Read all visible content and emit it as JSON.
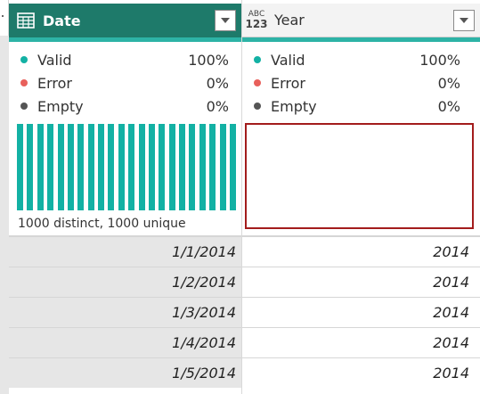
{
  "columns": {
    "date": {
      "title": "Date",
      "type_icon": "calendar-table-icon",
      "stats": {
        "valid_label": "Valid",
        "valid_value": "100%",
        "error_label": "Error",
        "error_value": "0%",
        "empty_label": "Empty",
        "empty_value": "0%"
      },
      "distribution_summary": "1000 distinct, 1000 unique",
      "histogram_bar_count": 22
    },
    "year": {
      "title": "Year",
      "type_icon_top": "ABC",
      "type_icon_bottom": "123",
      "stats": {
        "valid_label": "Valid",
        "valid_value": "100%",
        "error_label": "Error",
        "error_value": "0%",
        "empty_label": "Empty",
        "empty_value": "0%"
      }
    }
  },
  "rows": [
    {
      "date": "1/1/2014",
      "year": "2014"
    },
    {
      "date": "1/2/2014",
      "year": "2014"
    },
    {
      "date": "1/3/2014",
      "year": "2014"
    },
    {
      "date": "1/4/2014",
      "year": "2014"
    },
    {
      "date": "1/5/2014",
      "year": "2014"
    }
  ],
  "colors": {
    "header_accent": "#1e7a6a",
    "quality_bar": "#2db3a6",
    "valid_dot": "#13b1a4",
    "error_dot": "#e8605b",
    "empty_dot": "#555555",
    "histogram": "#13b1a4",
    "selection_border": "#a31c1c"
  }
}
